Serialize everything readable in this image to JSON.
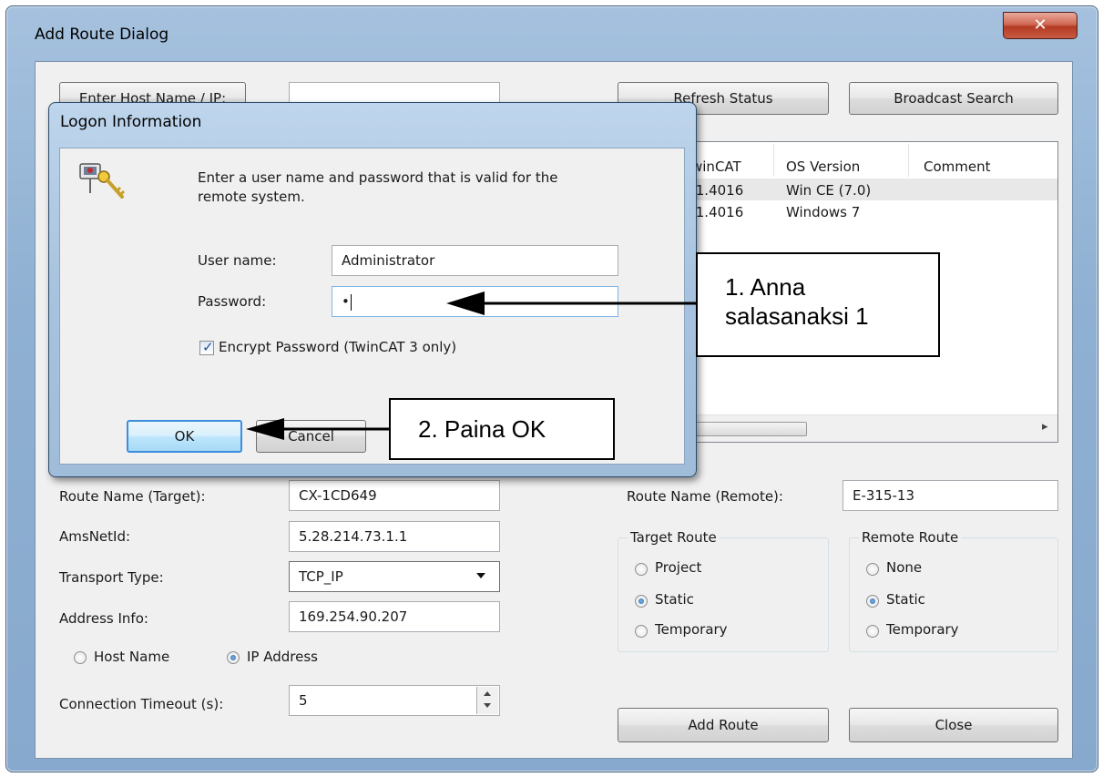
{
  "main_dialog": {
    "title": "Add Route Dialog",
    "close_glyph": "✕",
    "enter_host_button": "Enter Host Name / IP:",
    "host_input_value": "",
    "refresh_status_button": "Refresh Status",
    "broadcast_search_button": "Broadcast Search",
    "list": {
      "columns": [
        "winCAT",
        "OS Version",
        "Comment"
      ],
      "rows": [
        {
          "twincat": ".1.4016",
          "os": "Win CE (7.0)",
          "comment": ""
        },
        {
          "twincat": ".1.4016",
          "os": "Windows 7",
          "comment": ""
        }
      ],
      "scroll_right_glyph": "▸"
    },
    "route_name_target_label": "Route Name (Target):",
    "route_name_target_value": "CX-1CD649",
    "ams_net_id_label": "AmsNetId:",
    "ams_net_id_value": "5.28.214.73.1.1",
    "transport_type_label": "Transport Type:",
    "transport_type_value": "TCP_IP",
    "address_info_label": "Address Info:",
    "address_info_value": "169.254.90.207",
    "host_name_radio": "Host Name",
    "ip_address_radio": "IP Address",
    "address_mode": "ip",
    "connection_timeout_label": "Connection Timeout (s):",
    "connection_timeout_value": "5",
    "route_name_remote_label": "Route Name (Remote):",
    "route_name_remote_value": "E-315-13",
    "target_route": {
      "title": "Target Route",
      "options": [
        "Project",
        "Static",
        "Temporary"
      ],
      "selected": "Static"
    },
    "remote_route": {
      "title": "Remote Route",
      "options": [
        "None",
        "Static",
        "Temporary"
      ],
      "selected": "Static"
    },
    "add_route_button": "Add Route",
    "close_button": "Close"
  },
  "logon_dialog": {
    "title": "Logon Information",
    "message": [
      "Enter a user name and password that is valid for the",
      "remote system."
    ],
    "username_label": "User name:",
    "username_value": "Administrator",
    "password_label": "Password:",
    "password_value": "•",
    "encrypt_label": "Encrypt Password (TwinCAT 3 only)",
    "encrypt_checked": true,
    "ok_button": "OK",
    "cancel_button": "Cancel"
  },
  "annotations": {
    "callout1": [
      "1. Anna",
      "salasanaksi 1"
    ],
    "callout2": "2. Paina OK"
  },
  "colors": {
    "title_bar": "#8fb0d2",
    "close_button": "#c95c43",
    "dialog_bg": "#f0f0f0",
    "ok_focus": "#3c8dde"
  }
}
